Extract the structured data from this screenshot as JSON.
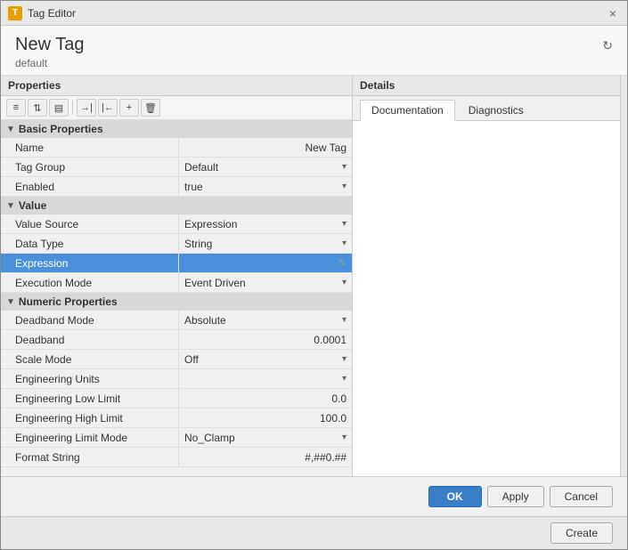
{
  "dialog": {
    "title": "Tag Editor",
    "title_icon": "T",
    "close_label": "×"
  },
  "header": {
    "title": "New Tag",
    "subtitle": "default",
    "refresh_icon": "↻"
  },
  "left_panel": {
    "header": "Properties",
    "toolbar": {
      "btn1": "≡",
      "btn2": "⇅",
      "btn3": "▤",
      "btn4": "→|",
      "btn5": "|←",
      "btn6": "+",
      "btn7": "🗑"
    }
  },
  "sections": [
    {
      "name": "Basic Properties",
      "toggle": "▼",
      "rows": [
        {
          "label": "Name",
          "value": "New Tag",
          "type": "text"
        },
        {
          "label": "Tag Group",
          "value": "Default",
          "type": "dropdown"
        },
        {
          "label": "Enabled",
          "value": "true",
          "type": "dropdown"
        }
      ]
    },
    {
      "name": "Value",
      "toggle": "▼",
      "rows": [
        {
          "label": "Value Source",
          "value": "Expression",
          "type": "dropdown"
        },
        {
          "label": "Data Type",
          "value": "String",
          "type": "dropdown"
        },
        {
          "label": "Expression",
          "value": "",
          "type": "edit",
          "highlighted": true
        },
        {
          "label": "Execution Mode",
          "value": "Event Driven",
          "type": "dropdown"
        }
      ]
    },
    {
      "name": "Numeric Properties",
      "toggle": "▼",
      "rows": [
        {
          "label": "Deadband Mode",
          "value": "Absolute",
          "type": "dropdown"
        },
        {
          "label": "Deadband",
          "value": "0.0001",
          "type": "text"
        },
        {
          "label": "Scale Mode",
          "value": "Off",
          "type": "dropdown"
        },
        {
          "label": "Engineering Units",
          "value": "",
          "type": "dropdown"
        },
        {
          "label": "Engineering Low Limit",
          "value": "0.0",
          "type": "text"
        },
        {
          "label": "Engineering High Limit",
          "value": "100.0",
          "type": "text"
        },
        {
          "label": "Engineering Limit Mode",
          "value": "No_Clamp",
          "type": "dropdown"
        },
        {
          "label": "Format String",
          "value": "#,##0.##",
          "type": "text"
        }
      ]
    }
  ],
  "right_panel": {
    "header": "Details",
    "tabs": [
      {
        "label": "Documentation",
        "active": true
      },
      {
        "label": "Diagnostics",
        "active": false
      }
    ]
  },
  "footer": {
    "ok_label": "OK",
    "apply_label": "Apply",
    "cancel_label": "Cancel",
    "create_label": "Create"
  }
}
